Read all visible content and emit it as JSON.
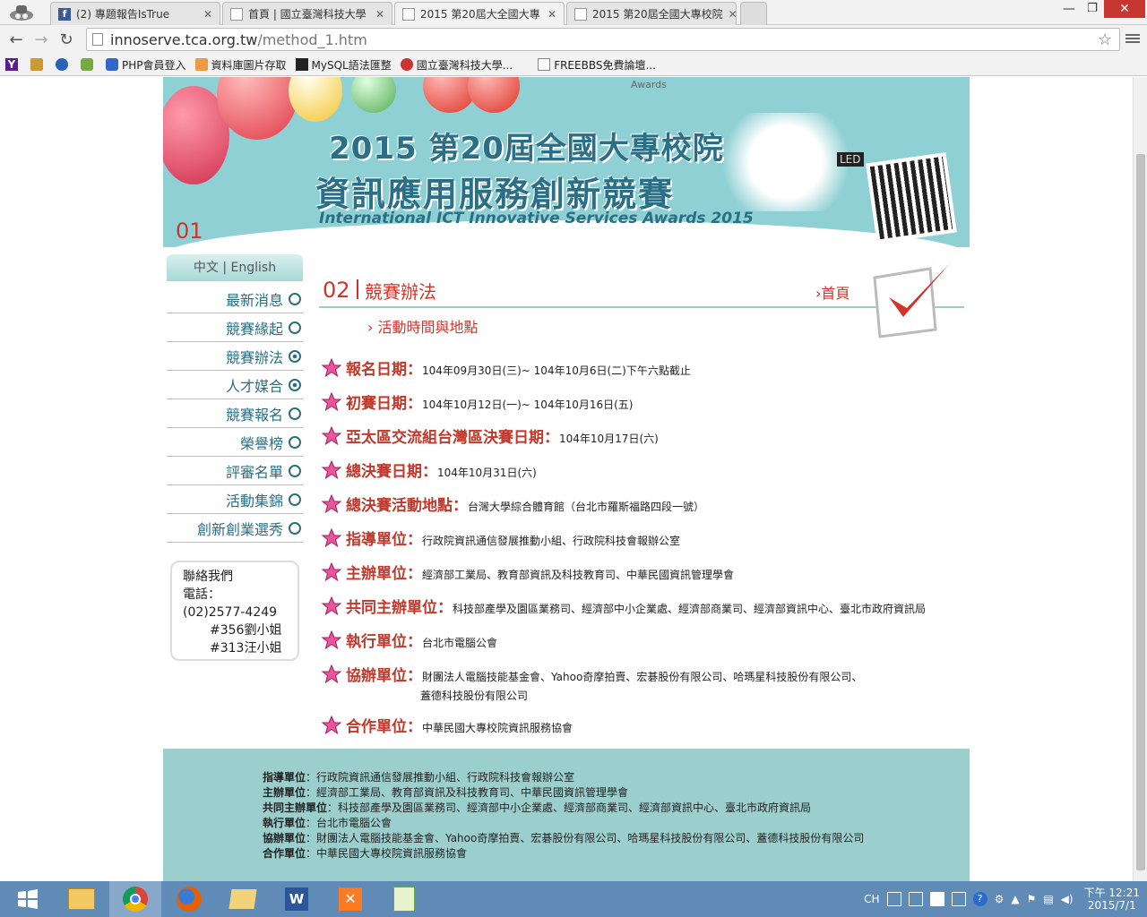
{
  "browser": {
    "tabs": [
      {
        "label": "(2) 專題報告IsTrue",
        "icon": "facebook-icon"
      },
      {
        "label": "首頁 | 國立臺灣科技大學"
      },
      {
        "label": "2015 第20屆大全國大專",
        "active": true
      },
      {
        "label": "2015 第20屆全國大專校院"
      }
    ],
    "url_host": "innoserve.tca.org.tw",
    "url_path": "/method_1.htm",
    "bookmarks": [
      {
        "label": ""
      },
      {
        "label": ""
      },
      {
        "label": ""
      },
      {
        "label": ""
      },
      {
        "label": "PHP會員登入"
      },
      {
        "label": "資料庫圖片存取"
      },
      {
        "label": "MySQL語法匯整"
      },
      {
        "label": "國立臺灣科技大學..."
      },
      {
        "label": "FREEBBS免費論壇..."
      }
    ]
  },
  "banner": {
    "awards": "Awards",
    "line1": "2015 第20屆全國大專校院",
    "line2": "資訊應用服務創新競賽",
    "line3": "International ICT Innovative Services Awards 2015",
    "section_num": "01",
    "led": "LED"
  },
  "sidebar": {
    "lang": "中文 | English",
    "items": [
      {
        "label": "最新消息"
      },
      {
        "label": "競賽緣起"
      },
      {
        "label": "競賽辦法"
      },
      {
        "label": "人才媒合"
      },
      {
        "label": "競賽報名"
      },
      {
        "label": "榮譽榜"
      },
      {
        "label": "評審名單"
      },
      {
        "label": "活動集錦"
      },
      {
        "label": "創新創業選秀"
      }
    ],
    "contact": {
      "title": "聯絡我們",
      "phone_label": "電話：",
      "phone": "(02)2577-4249",
      "ext1": "#356劉小姐",
      "ext2": "#313汪小姐"
    }
  },
  "main": {
    "section_num": "02",
    "title": "競賽辦法",
    "home": "首頁",
    "subtitle": "活動時間與地點",
    "rows": [
      {
        "label": "報名日期：",
        "value": "104年09月30日(三)~ 104年10月6日(二)下午六點截止"
      },
      {
        "label": "初賽日期：",
        "value": "104年10月12日(一)~ 104年10月16日(五)"
      },
      {
        "label": "亞太區交流組台灣區決賽日期：",
        "value": "104年10月17日(六)"
      },
      {
        "label": "總決賽日期：",
        "value": "104年10月31日(六)"
      },
      {
        "label": "總決賽活動地點：",
        "value": "台灣大學綜合體育館（台北市羅斯福路四段一號）"
      },
      {
        "label": "指導單位：",
        "value": "行政院資訊通信發展推動小組、行政院科技會報辦公室"
      },
      {
        "label": "主辦單位：",
        "value": "經濟部工業局、教育部資訊及科技教育司、中華民國資訊管理學會"
      },
      {
        "label": "共同主辦單位：",
        "value": "科技部產學及園區業務司、經濟部中小企業處、經濟部商業司、經濟部資訊中心、臺北市政府資訊局"
      },
      {
        "label": "執行單位：",
        "value": "台北市電腦公會"
      },
      {
        "label": "協辦單位：",
        "value": "財團法人電腦技能基金會、Yahoo奇摩拍賣、宏碁股份有限公司、哈瑪星科技股份有限公司、",
        "value2": "蓋德科技股份有限公司"
      },
      {
        "label": "合作單位：",
        "value": "中華民國大專校院資訊服務協會"
      }
    ]
  },
  "footer": {
    "lines": [
      {
        "label": "指導單位",
        "value": "：行政院資訊通信發展推動小組、行政院科技會報辦公室"
      },
      {
        "label": "主辦單位",
        "value": "：經濟部工業局、教育部資訊及科技教育司、中華民國資訊管理學會"
      },
      {
        "label": "共同主辦單位",
        "value": "：科技部產學及園區業務司、經濟部中小企業處、經濟部商業司、經濟部資訊中心、臺北市政府資訊局"
      },
      {
        "label": "執行單位",
        "value": "：台北市電腦公會"
      },
      {
        "label": "協辦單位",
        "value": "：財團法人電腦技能基金會、Yahoo奇摩拍賣、宏碁股份有限公司、哈瑪星科技股份有限公司、蓋德科技股份有限公司"
      },
      {
        "label": "合作單位",
        "value": "：中華民國大專校院資訊服務協會"
      }
    ]
  },
  "taskbar": {
    "ime": "CH",
    "time": "下午 12:21",
    "date": "2015/7/1"
  },
  "colors": {
    "accent_red": "#d2342a",
    "teal": "#2b6f86",
    "banner_bg": "#8fd0d4",
    "footer_bg": "#9bcfce"
  }
}
